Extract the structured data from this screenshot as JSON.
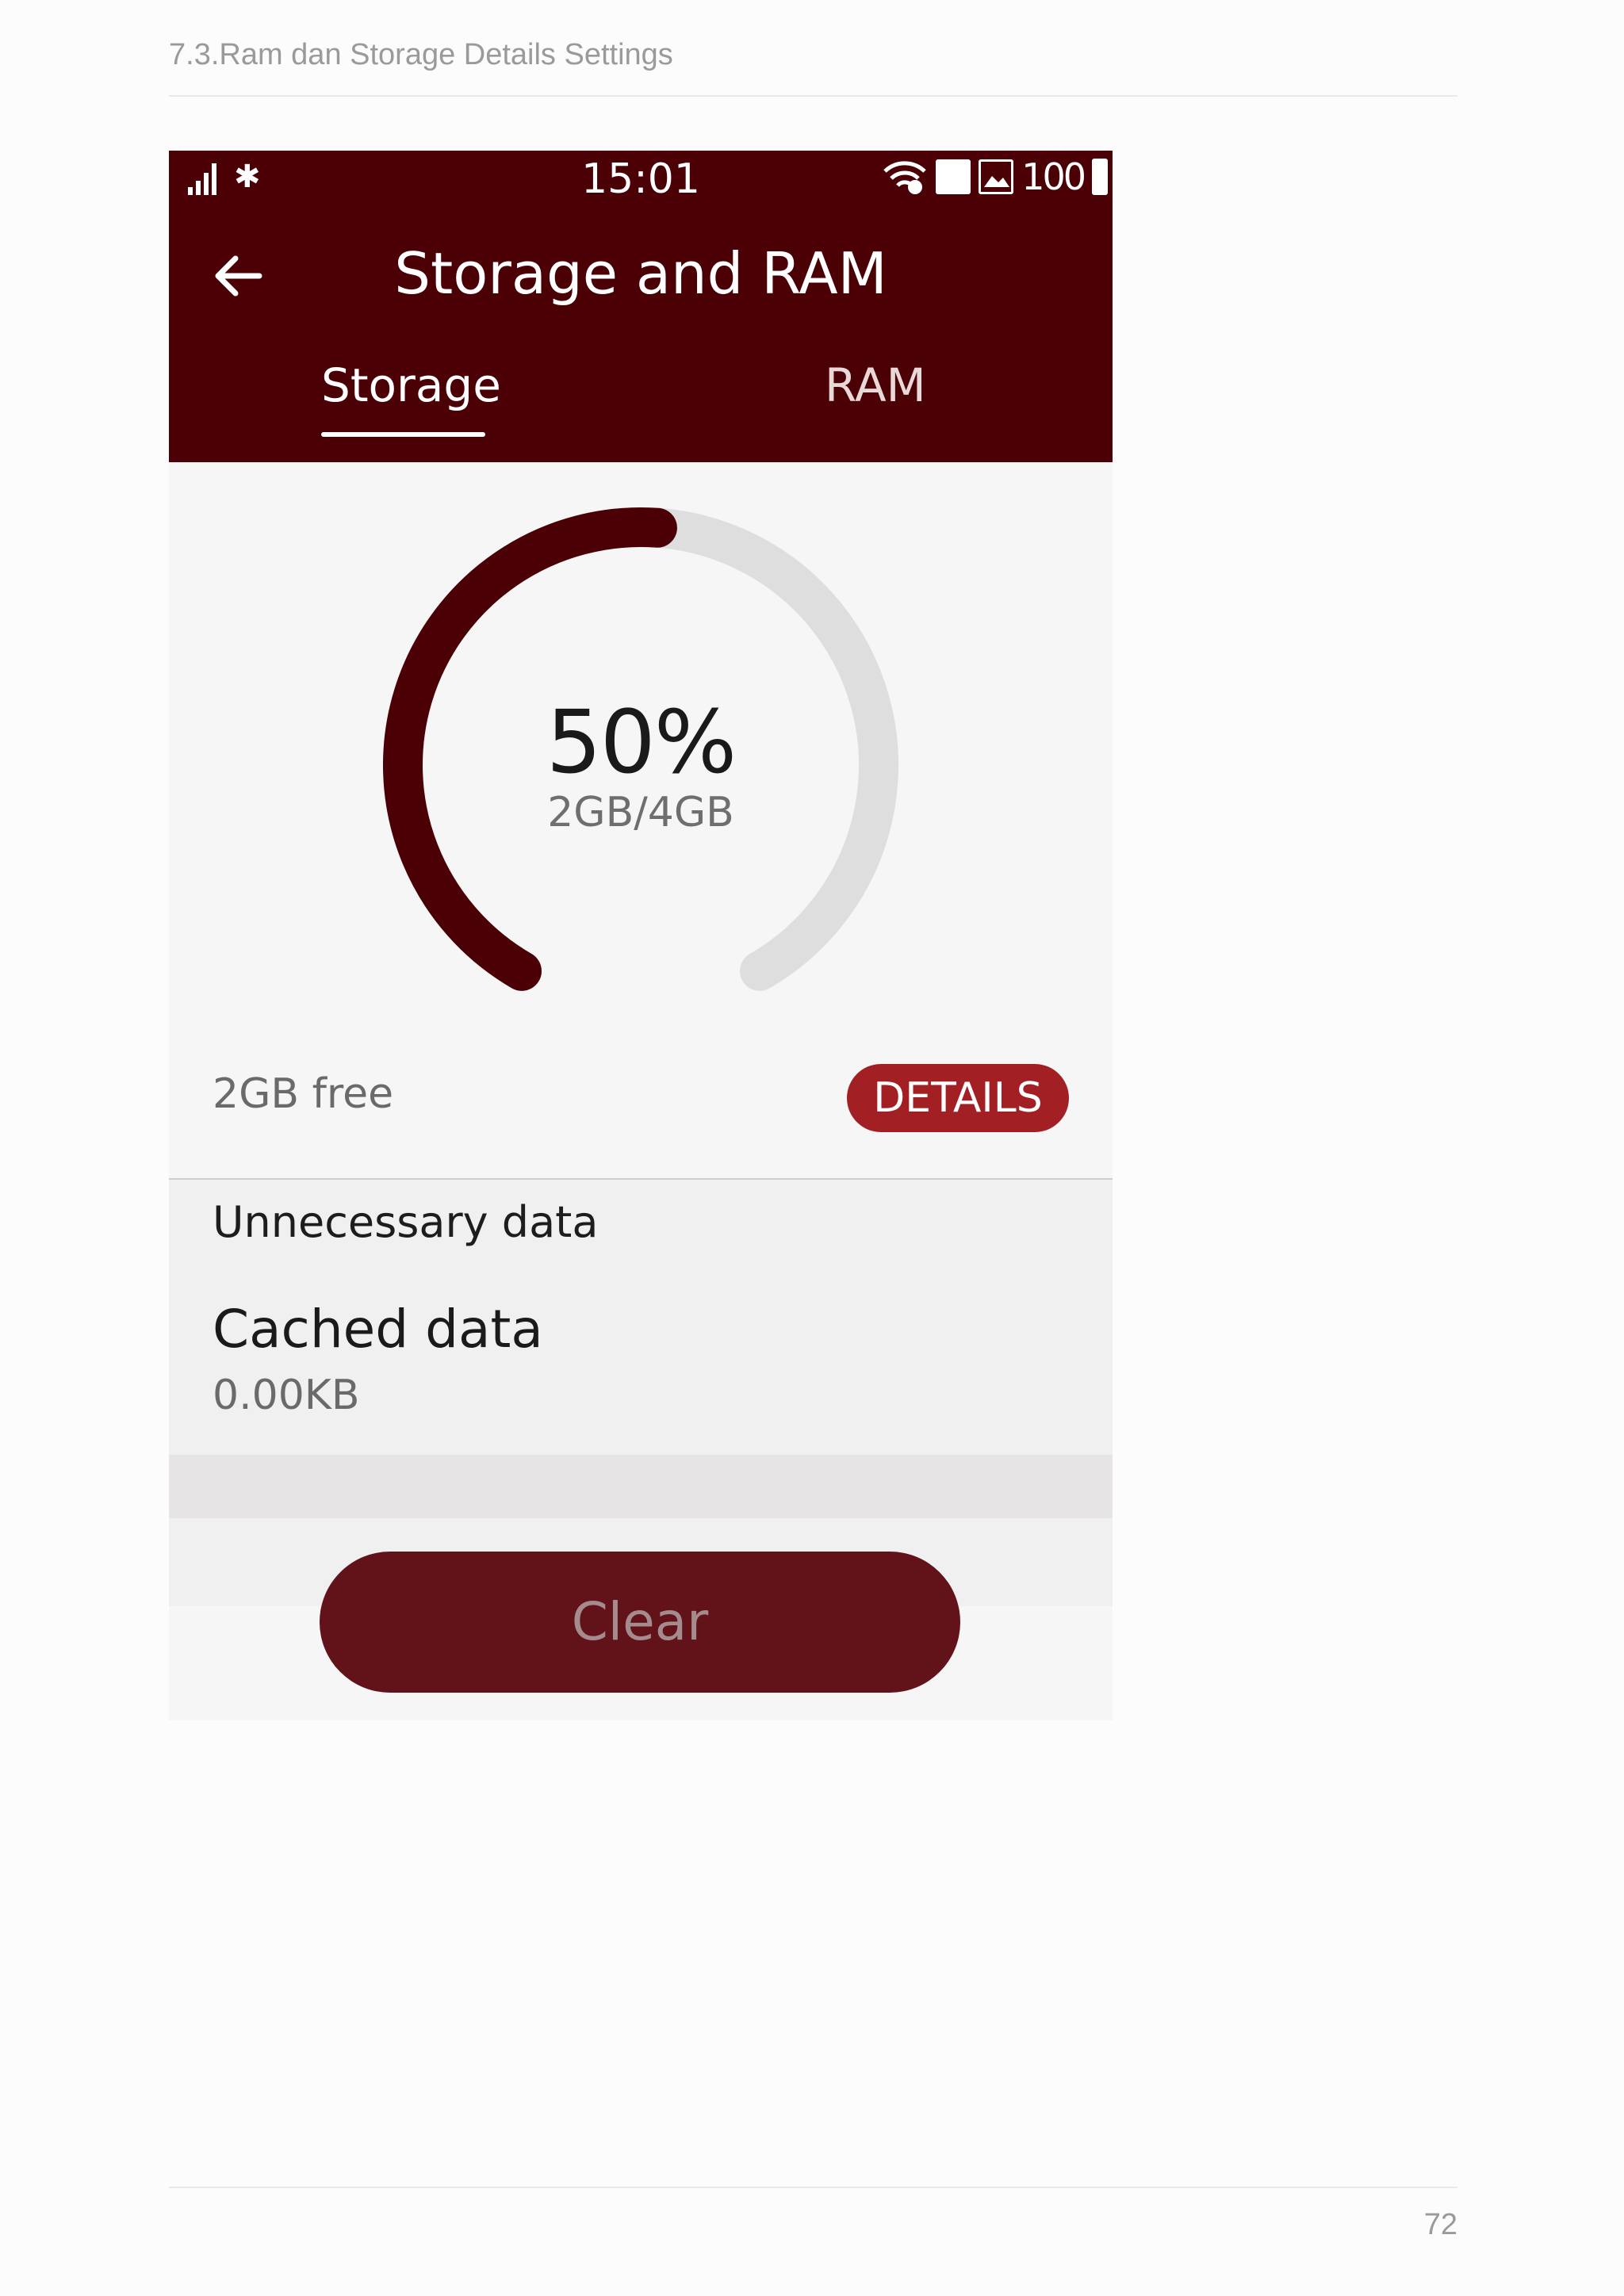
{
  "document": {
    "header": "7.3.Ram dan Storage Details Settings",
    "page_number": "72"
  },
  "status_bar": {
    "time": "15:01",
    "battery_level": "100",
    "icons": [
      "signal-icon",
      "bluetooth-icon",
      "wifi-icon",
      "usb-icon",
      "image-icon",
      "battery-icon"
    ]
  },
  "app_bar": {
    "title": "Storage and RAM",
    "back_icon": "arrow-left-icon",
    "tabs": [
      {
        "label": "Storage",
        "selected": true
      },
      {
        "label": "RAM",
        "selected": false
      }
    ]
  },
  "storage": {
    "percent_label": "50%",
    "used_fraction": 0.5,
    "usage": "2GB/4GB",
    "free": "2GB free",
    "details_label": "DETAILS"
  },
  "unnecessary": {
    "section_title": "Unnecessary data",
    "items": [
      {
        "title": "Cached data",
        "value": "0.00KB"
      }
    ]
  },
  "actions": {
    "clear_label": "Clear"
  },
  "colors": {
    "app_bar": "#4a0005",
    "gauge_fill": "#4a0005",
    "gauge_track": "#dedede",
    "details_button": "#a21f24",
    "clear_button": "#62131a"
  }
}
